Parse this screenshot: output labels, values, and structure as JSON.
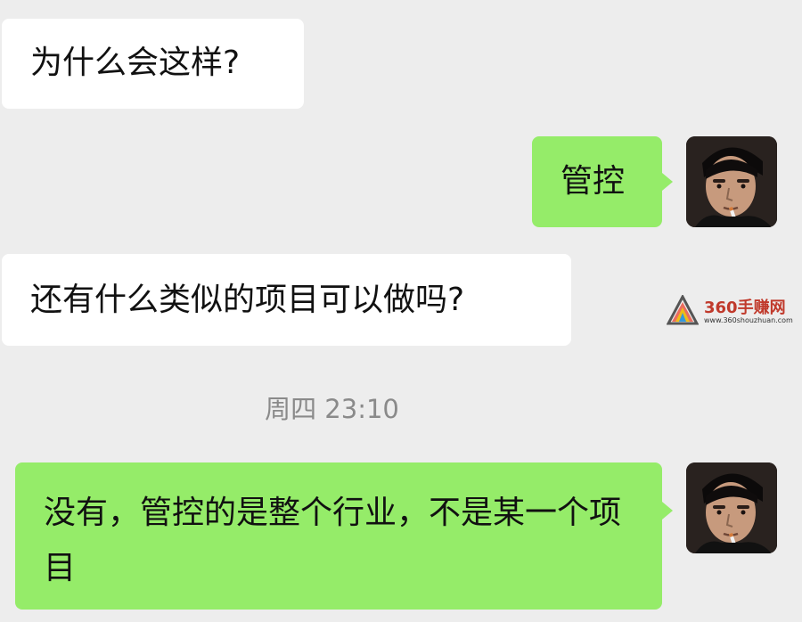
{
  "messages": [
    {
      "side": "incoming",
      "text": "为什么会这样?"
    },
    {
      "side": "outgoing",
      "text": "管控"
    },
    {
      "side": "incoming",
      "text": "还有什么类似的项目可以做吗?"
    },
    {
      "side": "outgoing",
      "text": "没有，管控的是整个行业，不是某一个项目"
    }
  ],
  "timestamp": "周四 23:10",
  "watermark": {
    "title": "360手赚网",
    "url": "www.360shouzhuan.com"
  },
  "colors": {
    "background": "#ededed",
    "incoming_bubble": "#ffffff",
    "outgoing_bubble": "#95ec69",
    "timestamp_text": "#8a8a8a"
  },
  "icons": [
    "avatar",
    "watermark-logo-icon"
  ]
}
